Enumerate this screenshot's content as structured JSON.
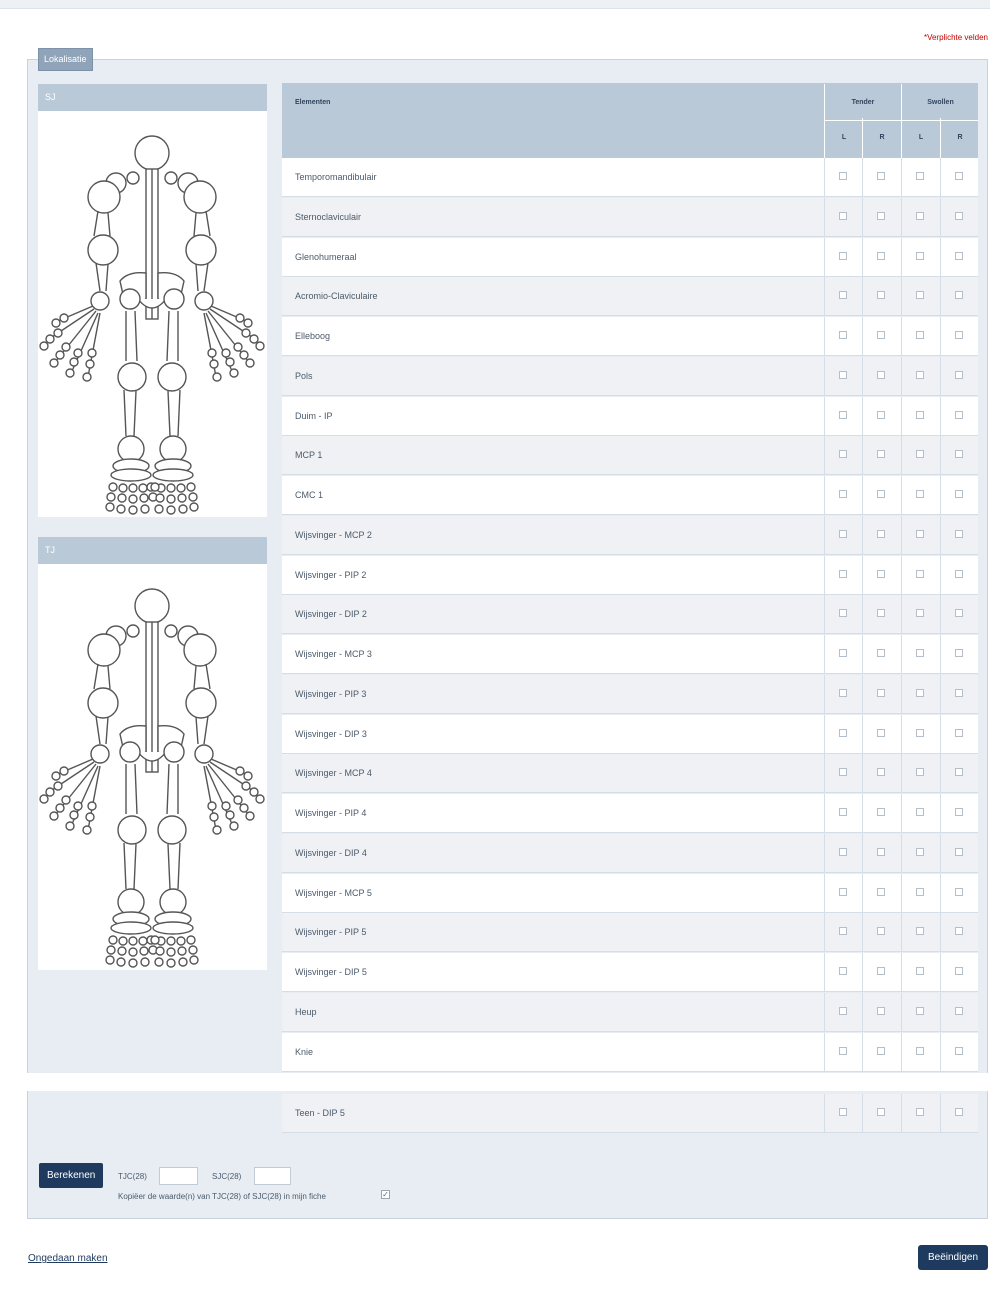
{
  "required_note": "*Verplichte velden",
  "section": {
    "legend": "Lokalisatie"
  },
  "figures": [
    {
      "title": "SJ"
    },
    {
      "title": "TJ"
    }
  ],
  "table": {
    "element_header": "Elementen",
    "groups": [
      "Tender",
      "Swollen"
    ],
    "sub_headers": [
      "L",
      "R",
      "L",
      "R"
    ],
    "rows": [
      "Temporomandibulair",
      "Sternoclaviculair",
      "Glenohumeraal",
      "Acromio-Claviculaire",
      "Elleboog",
      "Pols",
      "Duim - IP",
      "MCP 1",
      "CMC 1",
      "Wijsvinger - MCP 2",
      "Wijsvinger - PIP 2",
      "Wijsvinger - DIP 2",
      "Wijsvinger - MCP 3",
      "Wijsvinger - PIP 3",
      "Wijsvinger - DIP 3",
      "Wijsvinger - MCP 4",
      "Wijsvinger - PIP 4",
      "Wijsvinger - DIP 4",
      "Wijsvinger - MCP 5",
      "Wijsvinger - PIP 5",
      "Wijsvinger - DIP 5",
      "Heup",
      "Knie"
    ],
    "last_row": "Teen - DIP 5"
  },
  "calc": {
    "button": "Berekenen",
    "tjc_label": "TJC(28)",
    "sjc_label": "SJC(28)",
    "tjc_value": "",
    "sjc_value": "",
    "copy_text": "Kopiëer de waarde(n) van TJC(28) of SJC(28) in mijn fiche",
    "copy_checked": true
  },
  "footer": {
    "undo": "Ongedaan maken",
    "finish": "Beëindigen"
  }
}
